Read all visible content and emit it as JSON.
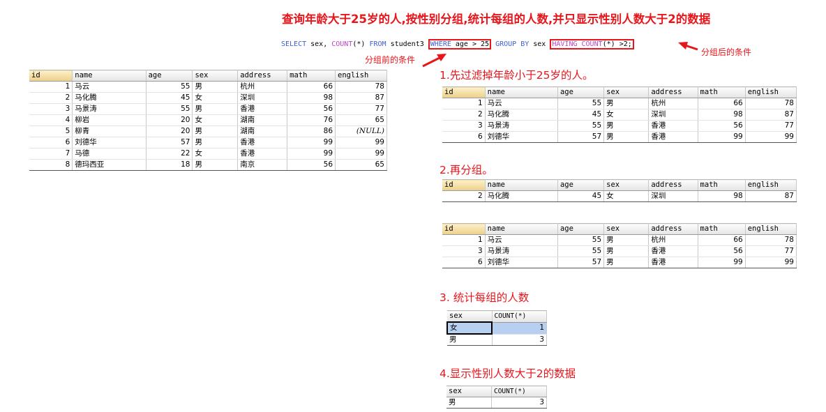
{
  "title": "查询年龄大于25岁的人,按性别分组,统计每组的人数,并只显示性别人数大于2的数据",
  "sql": {
    "p1": "SELECT",
    "p2": " sex, ",
    "p3": "COUNT",
    "p4": "(*) ",
    "p5": "FROM",
    "p6": " student3 ",
    "where_kw": "WHERE",
    "where_rest": " age > 25",
    "p7": " GROUP BY",
    "p8": " sex ",
    "having_kw": "HAVING",
    "having_fn": " COUNT",
    "having_rest": "(*) >2;"
  },
  "notes": {
    "before": "分组前的条件",
    "after": "分组后的条件"
  },
  "steps": {
    "s1": "1.先过滤掉年龄小于25岁的人。",
    "s2": "2.再分组。",
    "s3": "3. 统计每组的人数",
    "s4": "4.显示性别人数大于2的数据"
  },
  "columns": [
    "id",
    "name",
    "age",
    "sex",
    "address",
    "math",
    "english"
  ],
  "count_columns": [
    "sex",
    "COUNT(*)"
  ],
  "all_rows": [
    [
      "1",
      "马云",
      "55",
      "男",
      "杭州",
      "66",
      "78"
    ],
    [
      "2",
      "马化腾",
      "45",
      "女",
      "深圳",
      "98",
      "87"
    ],
    [
      "3",
      "马景涛",
      "55",
      "男",
      "香港",
      "56",
      "77"
    ],
    [
      "4",
      "柳岩",
      "20",
      "女",
      "湖南",
      "76",
      "65"
    ],
    [
      "5",
      "柳青",
      "20",
      "男",
      "湖南",
      "86",
      "(NULL)"
    ],
    [
      "6",
      "刘德华",
      "57",
      "男",
      "香港",
      "99",
      "99"
    ],
    [
      "7",
      "马德",
      "22",
      "女",
      "香港",
      "99",
      "99"
    ],
    [
      "8",
      "德玛西亚",
      "18",
      "男",
      "南京",
      "56",
      "65"
    ]
  ],
  "filtered_rows": [
    [
      "1",
      "马云",
      "55",
      "男",
      "杭州",
      "66",
      "78"
    ],
    [
      "2",
      "马化腾",
      "45",
      "女",
      "深圳",
      "98",
      "87"
    ],
    [
      "3",
      "马景涛",
      "55",
      "男",
      "香港",
      "56",
      "77"
    ],
    [
      "6",
      "刘德华",
      "57",
      "男",
      "香港",
      "99",
      "99"
    ]
  ],
  "group_female_rows": [
    [
      "2",
      "马化腾",
      "45",
      "女",
      "深圳",
      "98",
      "87"
    ]
  ],
  "group_male_rows": [
    [
      "1",
      "马云",
      "55",
      "男",
      "杭州",
      "66",
      "78"
    ],
    [
      "3",
      "马景涛",
      "55",
      "男",
      "香港",
      "56",
      "77"
    ],
    [
      "6",
      "刘德华",
      "57",
      "男",
      "香港",
      "99",
      "99"
    ]
  ],
  "count_rows": [
    [
      "女",
      "1"
    ],
    [
      "男",
      "3"
    ]
  ],
  "having_rows": [
    [
      "男",
      "3"
    ]
  ],
  "colors": {
    "accent_red": "#e8151b",
    "keyword_blue": "#3f5fcf",
    "function_magenta": "#c542c5",
    "selection": "#b7cff0"
  }
}
